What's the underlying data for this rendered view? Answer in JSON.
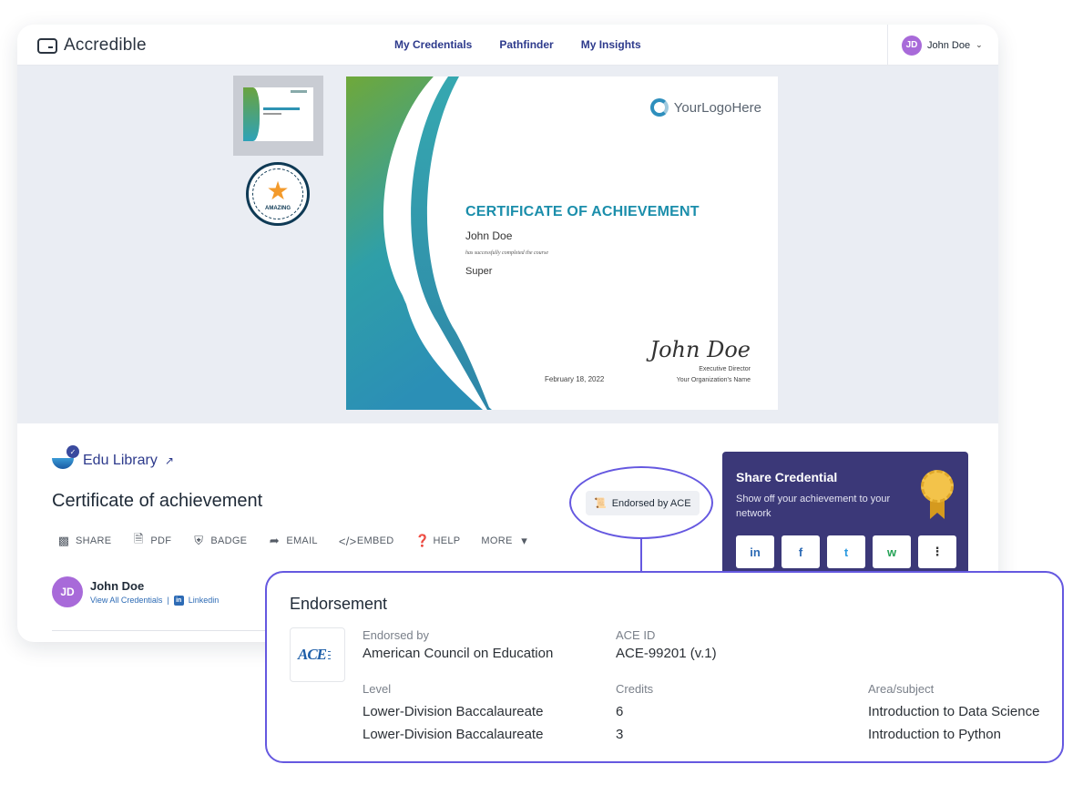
{
  "app": {
    "logo_text": "Accredible"
  },
  "nav": {
    "items": [
      "My Credentials",
      "Pathfinder",
      "My Insights"
    ]
  },
  "user": {
    "initials": "JD",
    "name": "John Doe"
  },
  "certificate": {
    "logo_text": "YourLogoHere",
    "title": "CERTIFICATE OF ACHIEVEMENT",
    "recipient": "John Doe",
    "completed_text": "has successfully completed the course",
    "course": "Super",
    "date": "February 18, 2022",
    "signature": "John Doe",
    "signer_role": "Executive Director",
    "org_name": "Your Organization's Name"
  },
  "badge": {
    "text": "AMAZING"
  },
  "issuer": {
    "name": "Edu Library"
  },
  "credential": {
    "title": "Certificate of achievement"
  },
  "actions": [
    "SHARE",
    "PDF",
    "BADGE",
    "EMAIL",
    "EMBED",
    "HELP",
    "MORE"
  ],
  "endorsed_chip": "Endorsed by ACE",
  "recipient": {
    "initials": "JD",
    "name": "John Doe",
    "view_all": "View All Credentials",
    "separator": "|",
    "linkedin": "Linkedin"
  },
  "share": {
    "title": "Share Credential",
    "subtitle": "Show off your achievement to your network",
    "buttons": [
      "in",
      "f",
      "t",
      "w",
      "⋮"
    ]
  },
  "endorsement": {
    "title": "Endorsement",
    "logo_text": "ACE",
    "endorsed_by_label": "Endorsed by",
    "endorsed_by_value": "American Council on Education",
    "ace_id_label": "ACE ID",
    "ace_id_value": "ACE-99201 (v.1)",
    "level_label": "Level",
    "credits_label": "Credits",
    "area_label": "Area/subject",
    "rows": [
      {
        "level": "Lower-Division Baccalaureate",
        "credits": "6",
        "area": "Introduction to Data Science"
      },
      {
        "level": "Lower-Division Baccalaureate",
        "credits": "3",
        "area": "Introduction to Python"
      }
    ]
  },
  "colors": {
    "accent": "#6558e0",
    "nav": "#2d3a8c",
    "share_bg": "#3b3878",
    "cert_title": "#1b8eab",
    "avatar": "#a86ad9"
  }
}
